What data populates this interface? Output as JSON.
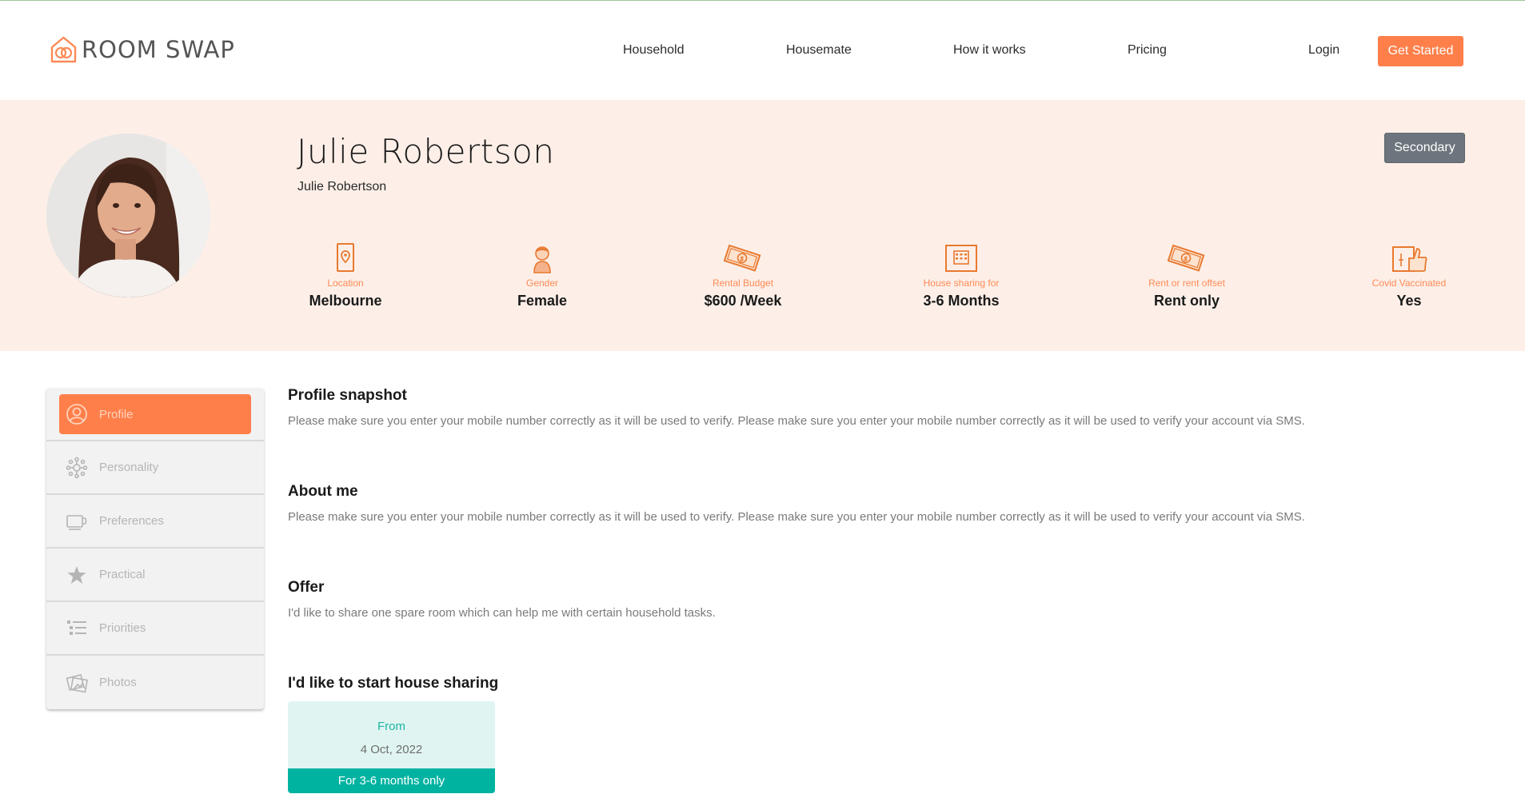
{
  "brand": {
    "name": "ROOM SWAP",
    "accent": "#ff7f4a",
    "teal": "#00b3a1",
    "banner_bg": "#fdefe8"
  },
  "nav": {
    "links": [
      "Household",
      "Housemate",
      "How it works",
      "Pricing"
    ],
    "login": "Login",
    "cta": "Get Started"
  },
  "profile": {
    "name": "Julie Robertson",
    "subtitle": "Julie Robertson",
    "badge_button": "Secondary",
    "stats": [
      {
        "icon": "location-pin-icon",
        "label": "Location",
        "value": "Melbourne"
      },
      {
        "icon": "person-icon",
        "label": "Gender",
        "value": "Female"
      },
      {
        "icon": "money-icon",
        "label": "Rental Budget",
        "value": "$600 /Week"
      },
      {
        "icon": "calendar-icon",
        "label": "House sharing for",
        "value": "3-6 Months"
      },
      {
        "icon": "money-icon",
        "label": "Rent or rent offset",
        "value": "Rent only"
      },
      {
        "icon": "vaccine-thumbs-up-icon",
        "label": "Covid Vaccinated",
        "value": "Yes"
      }
    ]
  },
  "sidebar": {
    "items": [
      {
        "label": "Profile",
        "icon": "user-circle-icon",
        "active": true
      },
      {
        "label": "Personality",
        "icon": "network-icon",
        "active": false
      },
      {
        "label": "Preferences",
        "icon": "cup-icon",
        "active": false
      },
      {
        "label": "Practical",
        "icon": "star-icon",
        "active": false
      },
      {
        "label": "Priorities",
        "icon": "list-icon",
        "active": false
      },
      {
        "label": "Photos",
        "icon": "photos-icon",
        "active": false
      }
    ]
  },
  "content": {
    "snapshot": {
      "title": "Profile snapshot",
      "text": "Please make sure you enter your mobile number correctly as it will be used to verify. Please make sure you enter your mobile number correctly as it will be used to verify your account via SMS."
    },
    "about": {
      "title": "About me",
      "text": "Please make sure you enter your mobile number correctly as it will be used to verify. Please make sure you enter your mobile number correctly as it will be used to verify your account via SMS."
    },
    "offer": {
      "title": "Offer",
      "text": "I'd like to share one spare room which can help me with certain household tasks."
    },
    "start": {
      "title": "I'd like to start house sharing",
      "from_label": "From",
      "date": "4 Oct, 2022",
      "duration": "For 3-6 months only"
    }
  }
}
